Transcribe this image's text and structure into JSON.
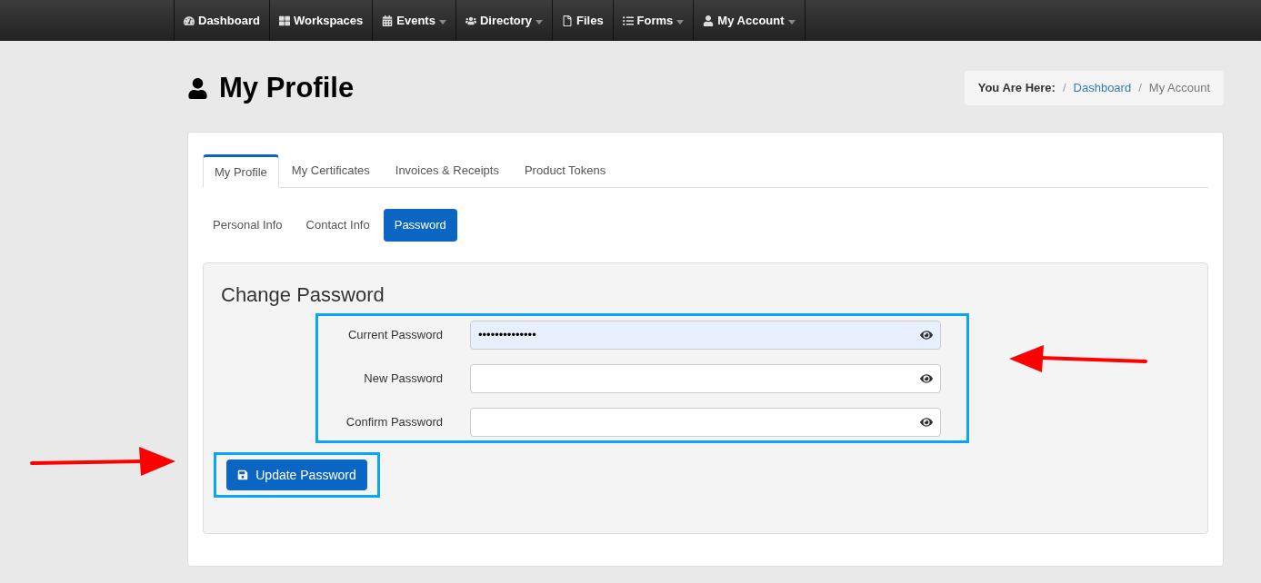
{
  "navbar": {
    "items": [
      {
        "label": "Dashboard",
        "has_caret": false
      },
      {
        "label": "Workspaces",
        "has_caret": false
      },
      {
        "label": "Events",
        "has_caret": true
      },
      {
        "label": "Directory",
        "has_caret": true
      },
      {
        "label": "Files",
        "has_caret": false
      },
      {
        "label": "Forms",
        "has_caret": true
      },
      {
        "label": "My Account",
        "has_caret": true
      }
    ]
  },
  "page_title": "My Profile",
  "breadcrumb": {
    "label": "You Are Here:",
    "separator": "/",
    "items": [
      {
        "label": "Dashboard",
        "link": true
      },
      {
        "label": "My Account",
        "link": false
      }
    ]
  },
  "tabs": [
    {
      "label": "My Profile",
      "selected": true
    },
    {
      "label": "My Certificates",
      "selected": false
    },
    {
      "label": "Invoices & Receipts",
      "selected": false
    },
    {
      "label": "Product Tokens",
      "selected": false
    }
  ],
  "pills": [
    {
      "label": "Personal Info",
      "selected": false
    },
    {
      "label": "Contact Info",
      "selected": false
    },
    {
      "label": "Password",
      "selected": true
    }
  ],
  "panel": {
    "title": "Change Password",
    "fields": [
      {
        "label": "Current Password",
        "value": "••••••••••••••",
        "autofilled": true
      },
      {
        "label": "New Password",
        "autofilled": false
      },
      {
        "label": "Confirm Password",
        "autofilled": false
      }
    ],
    "submit": "Update Password"
  }
}
